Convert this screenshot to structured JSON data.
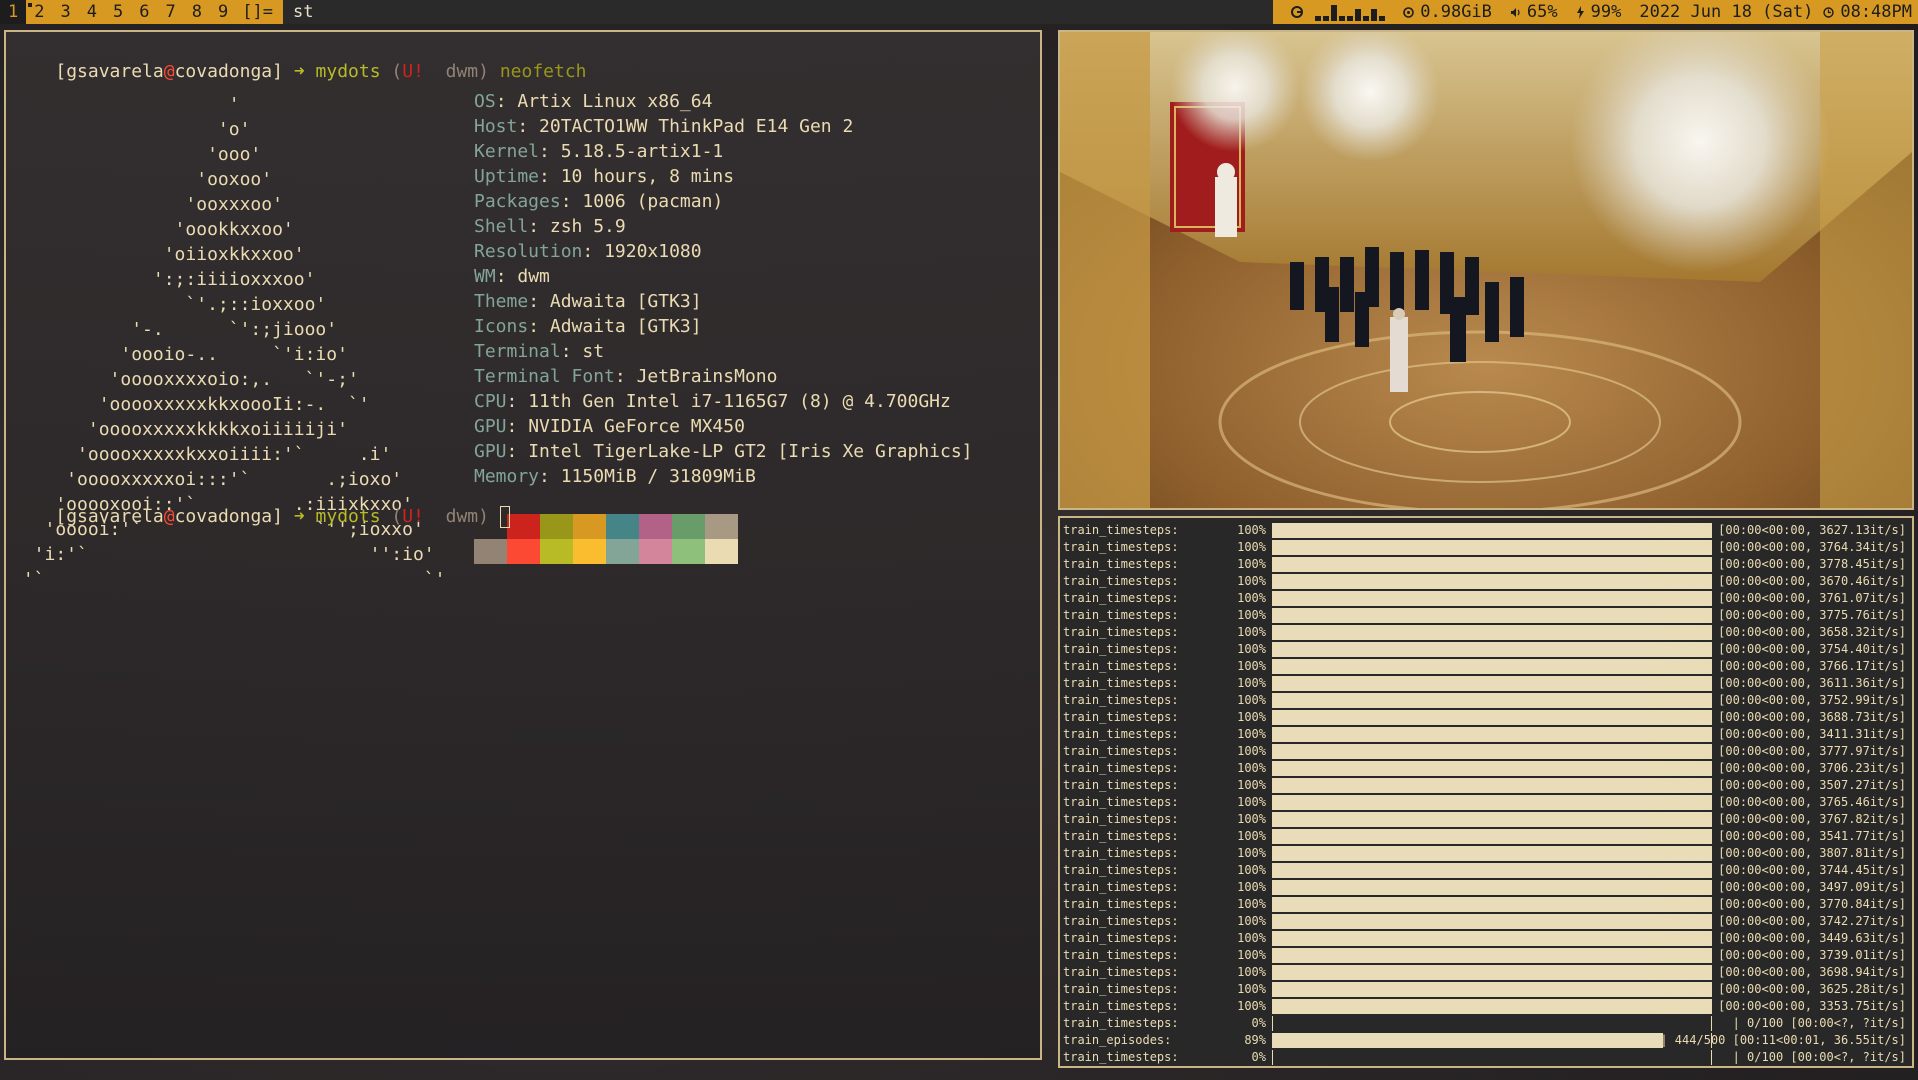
{
  "bar": {
    "tags": [
      {
        "label": "1",
        "selected": true,
        "occupied": false
      },
      {
        "label": "2",
        "selected": false,
        "occupied": true
      },
      {
        "label": "3",
        "selected": false,
        "occupied": false
      },
      {
        "label": "4",
        "selected": false,
        "occupied": false
      },
      {
        "label": "5",
        "selected": false,
        "occupied": false
      },
      {
        "label": "6",
        "selected": false,
        "occupied": false
      },
      {
        "label": "7",
        "selected": false,
        "occupied": false
      },
      {
        "label": "8",
        "selected": false,
        "occupied": false
      },
      {
        "label": "9",
        "selected": false,
        "occupied": false
      }
    ],
    "layout_symbol": "[]=",
    "window_title": "st",
    "status": {
      "memory": "0.98GiB",
      "volume": "65%",
      "battery": "99%",
      "date": "2022 Jun 18 (Sat)",
      "time": "08:48PM"
    },
    "colors": {
      "accent": "#d79921",
      "dark": "#1d1d1d"
    }
  },
  "terminal": {
    "prompt": {
      "user": "gsavarela",
      "at": "@",
      "host": "covadonga",
      "arrow": "➜",
      "dir": "mydots",
      "git_open": "(",
      "git_flag": "U!",
      "git_branch": "dwm",
      "git_close": ")"
    },
    "command": "neofetch",
    "logo": [
      "                    '",
      "                   'o'",
      "                  'ooo'",
      "                 'ooxoo'",
      "                'ooxxxoo'",
      "               'oookkxxoo'",
      "              'oiioxkkxxoo'",
      "             ':;:iiiioxxxoo'",
      "                `'.;::ioxxoo'",
      "           '-.      `':;jiooo'",
      "          'oooio-..     `'i:io'",
      "         'ooooxxxxoio:,.   `'-;'",
      "        'ooooxxxxxkkxoooIi:-.  `'",
      "       'ooooxxxxxkkkkxoiiiiiji'",
      "      'ooooxxxxxkxxoiiii:'`     .i'",
      "     'ooooxxxxxoi:::'`       .;ioxo'",
      "    'ooooxooi::'`         .:iiixkxxo'",
      "   'ooooi:'`                `'';ioxxo'",
      "  'i:'`                          '':io'",
      " '`                                   `'"
    ],
    "info": [
      {
        "key": "OS",
        "value": "Artix Linux x86_64"
      },
      {
        "key": "Host",
        "value": "20TACTO1WW ThinkPad E14 Gen 2"
      },
      {
        "key": "Kernel",
        "value": "5.18.5-artix1-1"
      },
      {
        "key": "Uptime",
        "value": "10 hours, 8 mins"
      },
      {
        "key": "Packages",
        "value": "1006 (pacman)"
      },
      {
        "key": "Shell",
        "value": "zsh 5.9"
      },
      {
        "key": "Resolution",
        "value": "1920x1080"
      },
      {
        "key": "WM",
        "value": "dwm"
      },
      {
        "key": "Theme",
        "value": "Adwaita [GTK3]"
      },
      {
        "key": "Icons",
        "value": "Adwaita [GTK3]"
      },
      {
        "key": "Terminal",
        "value": "st"
      },
      {
        "key": "Terminal Font",
        "value": "JetBrainsMono"
      },
      {
        "key": "CPU",
        "value": "11th Gen Intel i7-1165G7 (8) @ 4.700GHz"
      },
      {
        "key": "GPU",
        "value": "NVIDIA GeForce MX450"
      },
      {
        "key": "GPU",
        "value": "Intel TigerLake-LP GT2 [Iris Xe Graphics]"
      },
      {
        "key": "Memory",
        "value": "1150MiB / 31809MiB"
      }
    ],
    "palette": [
      [
        "#2e2a2a",
        "#cc241d",
        "#98971a",
        "#d79921",
        "#458588",
        "#b16286",
        "#689d6a",
        "#a89984"
      ],
      [
        "#928374",
        "#fb4934",
        "#b8bb26",
        "#fabd2f",
        "#83a598",
        "#d3869b",
        "#8ec07c",
        "#ebdbb2"
      ]
    ]
  },
  "progress": {
    "rows": [
      {
        "label": "train_timesteps:",
        "pct": "100%",
        "fill": 1.0,
        "stat": "| 100/100 [00:00<00:00, 3627.13it/s]"
      },
      {
        "label": "train_timesteps:",
        "pct": "100%",
        "fill": 1.0,
        "stat": "| 100/100 [00:00<00:00, 3764.34it/s]"
      },
      {
        "label": "train_timesteps:",
        "pct": "100%",
        "fill": 1.0,
        "stat": "| 100/100 [00:00<00:00, 3778.45it/s]"
      },
      {
        "label": "train_timesteps:",
        "pct": "100%",
        "fill": 1.0,
        "stat": "| 100/100 [00:00<00:00, 3670.46it/s]"
      },
      {
        "label": "train_timesteps:",
        "pct": "100%",
        "fill": 1.0,
        "stat": "| 100/100 [00:00<00:00, 3761.07it/s]"
      },
      {
        "label": "train_timesteps:",
        "pct": "100%",
        "fill": 1.0,
        "stat": "| 100/100 [00:00<00:00, 3775.76it/s]"
      },
      {
        "label": "train_timesteps:",
        "pct": "100%",
        "fill": 1.0,
        "stat": "| 100/100 [00:00<00:00, 3658.32it/s]"
      },
      {
        "label": "train_timesteps:",
        "pct": "100%",
        "fill": 1.0,
        "stat": "| 100/100 [00:00<00:00, 3754.40it/s]"
      },
      {
        "label": "train_timesteps:",
        "pct": "100%",
        "fill": 1.0,
        "stat": "| 100/100 [00:00<00:00, 3766.17it/s]"
      },
      {
        "label": "train_timesteps:",
        "pct": "100%",
        "fill": 1.0,
        "stat": "| 100/100 [00:00<00:00, 3611.36it/s]"
      },
      {
        "label": "train_timesteps:",
        "pct": "100%",
        "fill": 1.0,
        "stat": "| 100/100 [00:00<00:00, 3752.99it/s]"
      },
      {
        "label": "train_timesteps:",
        "pct": "100%",
        "fill": 1.0,
        "stat": "| 100/100 [00:00<00:00, 3688.73it/s]"
      },
      {
        "label": "train_timesteps:",
        "pct": "100%",
        "fill": 1.0,
        "stat": "| 100/100 [00:00<00:00, 3411.31it/s]"
      },
      {
        "label": "train_timesteps:",
        "pct": "100%",
        "fill": 1.0,
        "stat": "| 100/100 [00:00<00:00, 3777.97it/s]"
      },
      {
        "label": "train_timesteps:",
        "pct": "100%",
        "fill": 1.0,
        "stat": "| 100/100 [00:00<00:00, 3706.23it/s]"
      },
      {
        "label": "train_timesteps:",
        "pct": "100%",
        "fill": 1.0,
        "stat": "| 100/100 [00:00<00:00, 3507.27it/s]"
      },
      {
        "label": "train_timesteps:",
        "pct": "100%",
        "fill": 1.0,
        "stat": "| 100/100 [00:00<00:00, 3765.46it/s]"
      },
      {
        "label": "train_timesteps:",
        "pct": "100%",
        "fill": 1.0,
        "stat": "| 100/100 [00:00<00:00, 3767.82it/s]"
      },
      {
        "label": "train_timesteps:",
        "pct": "100%",
        "fill": 1.0,
        "stat": "| 100/100 [00:00<00:00, 3541.77it/s]"
      },
      {
        "label": "train_timesteps:",
        "pct": "100%",
        "fill": 1.0,
        "stat": "| 100/100 [00:00<00:00, 3807.81it/s]"
      },
      {
        "label": "train_timesteps:",
        "pct": "100%",
        "fill": 1.0,
        "stat": "| 100/100 [00:00<00:00, 3744.45it/s]"
      },
      {
        "label": "train_timesteps:",
        "pct": "100%",
        "fill": 1.0,
        "stat": "| 100/100 [00:00<00:00, 3497.09it/s]"
      },
      {
        "label": "train_timesteps:",
        "pct": "100%",
        "fill": 1.0,
        "stat": "| 100/100 [00:00<00:00, 3770.84it/s]"
      },
      {
        "label": "train_timesteps:",
        "pct": "100%",
        "fill": 1.0,
        "stat": "| 100/100 [00:00<00:00, 3742.27it/s]"
      },
      {
        "label": "train_timesteps:",
        "pct": "100%",
        "fill": 1.0,
        "stat": "| 100/100 [00:00<00:00, 3449.63it/s]"
      },
      {
        "label": "train_timesteps:",
        "pct": "100%",
        "fill": 1.0,
        "stat": "| 100/100 [00:00<00:00, 3739.01it/s]"
      },
      {
        "label": "train_timesteps:",
        "pct": "100%",
        "fill": 1.0,
        "stat": "| 100/100 [00:00<00:00, 3698.94it/s]"
      },
      {
        "label": "train_timesteps:",
        "pct": "100%",
        "fill": 1.0,
        "stat": "| 100/100 [00:00<00:00, 3625.28it/s]"
      },
      {
        "label": "train_timesteps:",
        "pct": "100%",
        "fill": 1.0,
        "stat": "| 100/100 [00:00<00:00, 3353.75it/s]"
      },
      {
        "label": "train_timesteps:",
        "pct": "0%",
        "fill": 0.0,
        "stat": "| 0/100 [00:00<?, ?it/s]"
      },
      {
        "label": "train_episodes:",
        "pct": "89%",
        "fill": 0.89,
        "stat": "| 444/500 [00:11<00:01, 36.55it/s]"
      },
      {
        "label": "train_timesteps:",
        "pct": "0%",
        "fill": 0.0,
        "stat": "| 0/100 [00:00<?, ?it/s]"
      }
    ]
  },
  "icons": {
    "cpu": "cpu-graph-icon",
    "memory": "memory-icon",
    "volume": "volume-icon",
    "battery": "battery-icon",
    "clock": "clock-icon",
    "occupied": "occupied-tag-indicator"
  }
}
